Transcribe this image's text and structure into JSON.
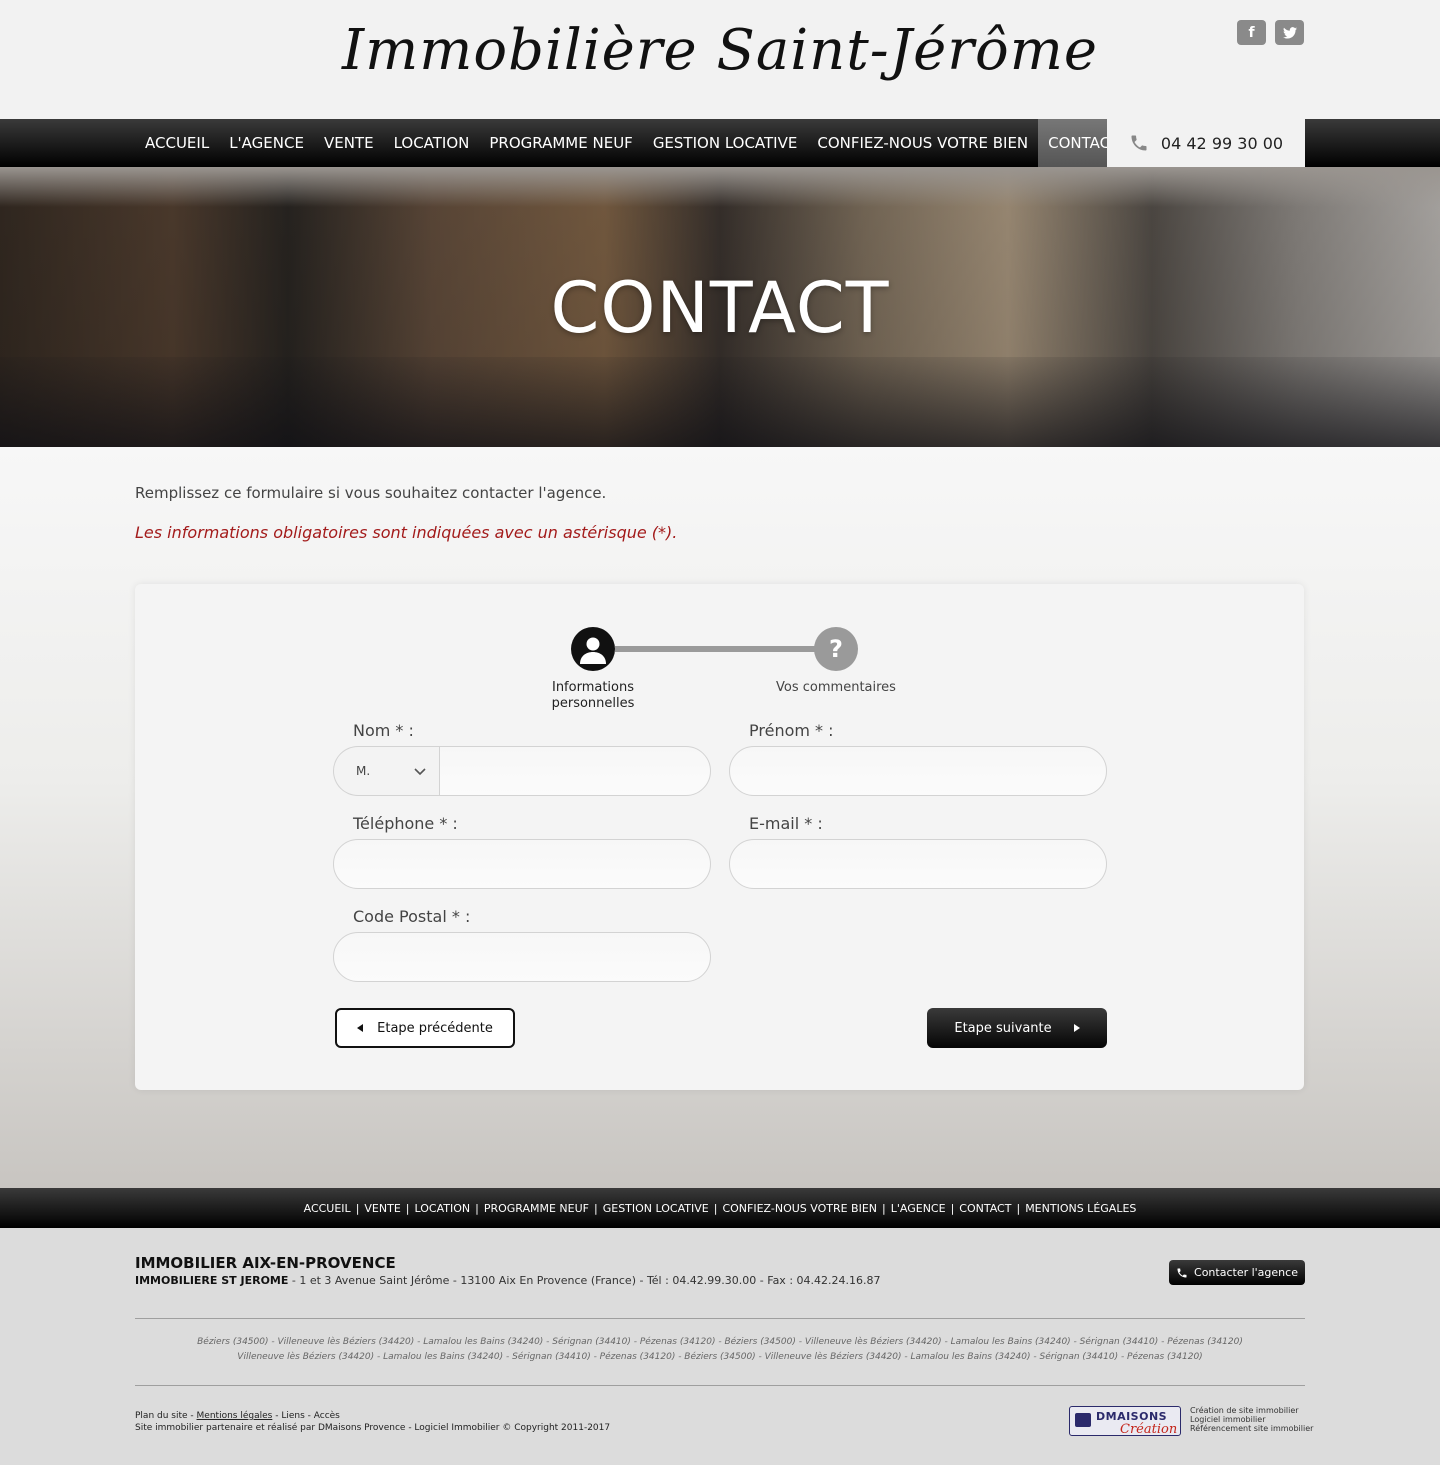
{
  "header": {
    "logo_text": "Immobilière Saint-Jérôme",
    "social": {
      "facebook": "f",
      "twitter": "t"
    },
    "phone": "04 42 99 30 00"
  },
  "nav": {
    "items": [
      "ACCUEIL",
      "L'AGENCE",
      "VENTE",
      "LOCATION",
      "PROGRAMME NEUF",
      "GESTION LOCATIVE",
      "CONFIEZ-NOUS VOTRE BIEN",
      "CONTACT"
    ],
    "active": "CONTACT"
  },
  "hero": {
    "title": "CONTACT"
  },
  "main": {
    "intro": "Remplissez ce formulaire si vous souhaitez contacter l'agence.",
    "required_note": "Les informations obligatoires sont indiquées avec un astérisque (*).",
    "steps": [
      {
        "label": "Informations personnelles",
        "icon": "user-icon"
      },
      {
        "label": "Vos commentaires",
        "icon": "question-icon",
        "symbol": "?"
      }
    ],
    "fields": {
      "nom_label": "Nom * :",
      "civilite_value": "M.",
      "prenom_label": "Prénom * :",
      "telephone_label": "Téléphone * :",
      "email_label": "E-mail * :",
      "code_postal_label": "Code Postal * :"
    },
    "buttons": {
      "prev": "Etape précédente",
      "next": "Etape suivante"
    }
  },
  "footer_nav": [
    "ACCUEIL",
    "VENTE",
    "LOCATION",
    "PROGRAMME NEUF",
    "GESTION LOCATIVE",
    "CONFIEZ-NOUS VOTRE BIEN",
    "L'AGENCE",
    "CONTACT",
    "MENTIONS LÉGALES"
  ],
  "footer": {
    "title": "IMMOBILIER AIX-EN-PROVENCE",
    "agency_name": "IMMOBILIERE ST JEROME",
    "address": " - 1 et 3 Avenue Saint Jérôme - 13100 Aix En Provence (France) - Tél : 04.42.99.30.00 - Fax : 04.42.24.16.87",
    "contact_button": "Contacter l'agence",
    "cities_line1": "Béziers (34500) - Villeneuve lès Béziers (34420) - Lamalou les Bains (34240) - Sérignan (34410) - Pézenas (34120) - Béziers (34500) - Villeneuve lès Béziers (34420) - Lamalou les Bains (34240) - Sérignan (34410) - Pézenas (34120)",
    "cities_line2": "Villeneuve lès Béziers (34420) - Lamalou les Bains (34240) - Sérignan (34410) - Pézenas (34120) - Béziers (34500) - Villeneuve lès Béziers (34420) - Lamalou les Bains (34240) - Sérignan (34410) - Pézenas (34120)",
    "links": {
      "plan": "Plan du site",
      "mentions": "Mentions légales",
      "liens": "Liens",
      "acces": "Accès",
      "sep": " - "
    },
    "copyright": "Site immobilier partenaire et réalisé par DMaisons Provence - Logiciel Immobilier © Copyright 2011-2017",
    "dm_logo": {
      "name": "DMAISONS",
      "sub": "Création"
    },
    "dm_tags": [
      "Création de site immobilier",
      "Logiciel immobilier",
      "Référencement site immobilier"
    ]
  },
  "colors": {
    "accent_red": "#a31b1b",
    "nav_bg": "#000000",
    "active_nav": "#666666"
  }
}
